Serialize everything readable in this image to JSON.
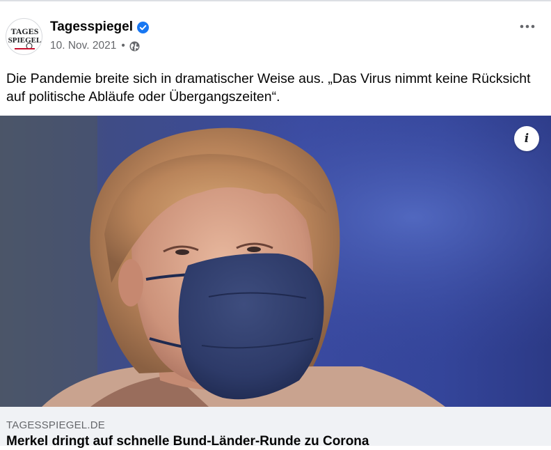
{
  "post": {
    "page_name": "Tagesspiegel",
    "avatar_text_line1": "TAGES",
    "avatar_text_line2": "SPIEGEL",
    "date": "10. Nov. 2021",
    "separator": "•",
    "caption": "Die Pandemie breite sich in dramatischer Weise aus. „Das Virus nimmt keine Rücksicht auf politische Abläufe oder Übergangszeiten“.",
    "info_label": "i",
    "more_label": "•••"
  },
  "link_preview": {
    "domain": "TAGESSPIEGEL.DE",
    "title": "Merkel dringt auf schnelle Bund-Länder-Runde zu Corona"
  },
  "icons": {
    "verified": "verified-badge-icon",
    "privacy": "globe-icon",
    "more": "more-options-icon",
    "info": "info-icon"
  },
  "colors": {
    "verified_blue": "#1877f2",
    "secondary_text": "#65676b",
    "preview_bg": "#f0f2f5"
  }
}
